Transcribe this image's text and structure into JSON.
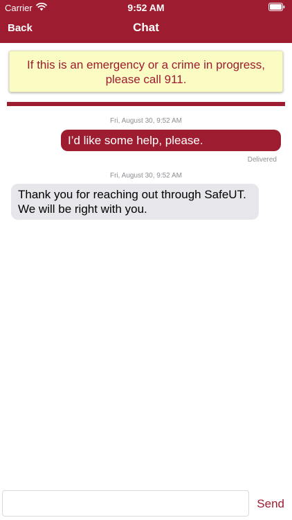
{
  "status_bar": {
    "carrier": "Carrier",
    "time": "9:52 AM"
  },
  "nav": {
    "back_label": "Back",
    "title": "Chat"
  },
  "notice": {
    "line1": "If this is an emergency or a crime in progress,",
    "line2": "please call 911."
  },
  "messages": [
    {
      "timestamp": "Fri, August 30, 9:52 AM",
      "direction": "outgoing",
      "text": "I’d like some help, please.",
      "status": "Delivered"
    },
    {
      "timestamp": "Fri, August 30, 9:52 AM",
      "direction": "incoming",
      "line1": "Thank you for reaching out through SafeUT.",
      "line2": "We will be right with you."
    }
  ],
  "composer": {
    "value": "",
    "send_label": "Send"
  },
  "colors": {
    "accent": "#9e1c2f",
    "notice_background": "#fbfbc4",
    "incoming_bubble": "#e6e6eb",
    "meta_text": "#8e8e93"
  }
}
